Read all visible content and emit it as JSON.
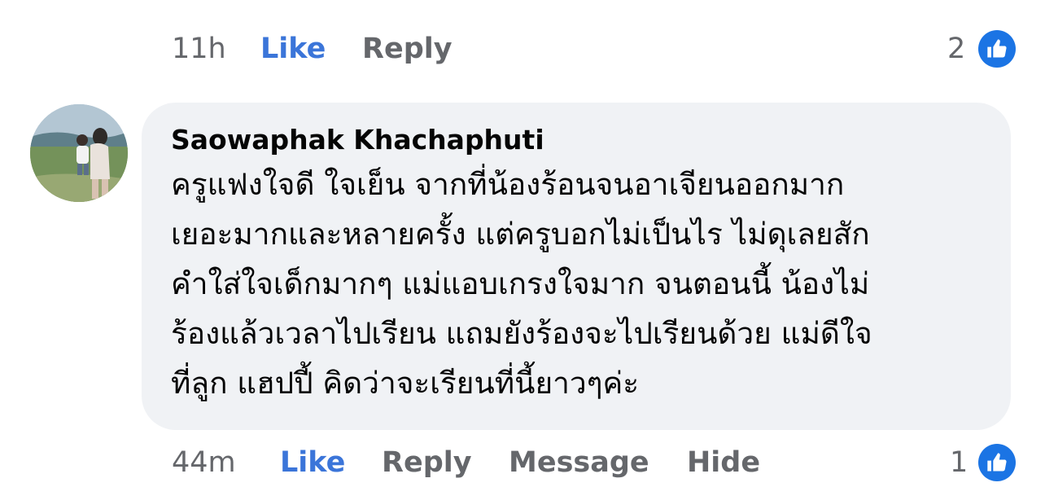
{
  "previous_comment": {
    "time": "11h",
    "like_label": "Like",
    "reply_label": "Reply",
    "reaction_count": "2",
    "reaction_icon": "thumbs-up-icon"
  },
  "comment": {
    "author": "Saowaphak Khachaphuti",
    "lines": [
      "ครูแฟงใจดี ใจเย็น จากที่น้องร้อนจนอาเจียนออกมาก",
      "เยอะมากและหลายครั้ง แต่ครูบอกไม่เป็นไร ไม่ดุเลยสัก",
      "คำใส่ใจเด็กมากๆ แม่แอบเกรงใจมาก จนตอนนี้ น้องไม่",
      "ร้องแล้วเวลาไปเรียน แถมยังร้องจะไปเรียนด้วย แม่ดีใจ",
      "ที่ลูก แฮปปี้ คิดว่าจะเรียนที่นี้ยาวๆค่ะ"
    ],
    "time": "44m",
    "like_label": "Like",
    "reply_label": "Reply",
    "message_label": "Message",
    "hide_label": "Hide",
    "reaction_count": "1",
    "reaction_icon": "thumbs-up-icon"
  },
  "colors": {
    "like_blue": "#3b75d9",
    "badge_blue": "#1b74e4",
    "muted_gray": "#65676b",
    "bubble_bg": "#f0f2f5"
  }
}
